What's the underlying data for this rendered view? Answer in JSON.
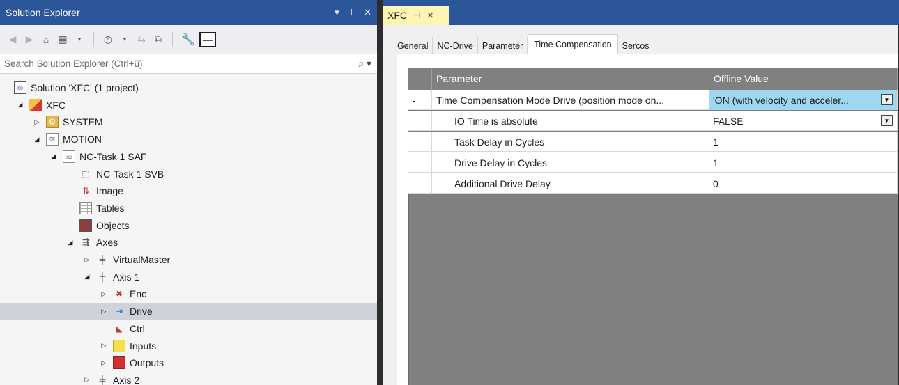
{
  "solution_explorer": {
    "title": "Solution Explorer",
    "title_controls": [
      "▾",
      "⊥",
      "✕"
    ],
    "search_placeholder": "Search Solution Explorer (Ctrl+ü)",
    "tree": [
      {
        "label": "Solution 'XFC' (1 project)",
        "level": 0,
        "expander": "",
        "icon": "solution-icon"
      },
      {
        "label": "XFC",
        "level": 1,
        "expander": "◢",
        "icon": "project-icon"
      },
      {
        "label": "SYSTEM",
        "level": 2,
        "expander": "▷",
        "icon": "system-icon"
      },
      {
        "label": "MOTION",
        "level": 2,
        "expander": "◢",
        "icon": "motion-icon"
      },
      {
        "label": "NC-Task 1 SAF",
        "level": 3,
        "expander": "◢",
        "icon": "nc-task-icon"
      },
      {
        "label": "NC-Task 1 SVB",
        "level": 4,
        "expander": "",
        "icon": "svb-icon"
      },
      {
        "label": "Image",
        "level": 4,
        "expander": "",
        "icon": "image-icon"
      },
      {
        "label": "Tables",
        "level": 4,
        "expander": "",
        "icon": "tables-icon"
      },
      {
        "label": "Objects",
        "level": 4,
        "expander": "",
        "icon": "objects-icon"
      },
      {
        "label": "Axes",
        "level": 4,
        "expander": "◢",
        "icon": "axes-icon"
      },
      {
        "label": "VirtualMaster",
        "level": 5,
        "expander": "▷",
        "icon": "axis-icon"
      },
      {
        "label": "Axis 1",
        "level": 5,
        "expander": "◢",
        "icon": "axis-icon"
      },
      {
        "label": "Enc",
        "level": 6,
        "expander": "▷",
        "icon": "encoder-icon"
      },
      {
        "label": "Drive",
        "level": 6,
        "expander": "▷",
        "icon": "drive-icon",
        "selected": true
      },
      {
        "label": "Ctrl",
        "level": 6,
        "expander": "",
        "icon": "controller-icon"
      },
      {
        "label": "Inputs",
        "level": 6,
        "expander": "▷",
        "icon": "inputs-icon"
      },
      {
        "label": "Outputs",
        "level": 6,
        "expander": "▷",
        "icon": "outputs-icon"
      },
      {
        "label": "Axis 2",
        "level": 5,
        "expander": "▷",
        "icon": "axis-icon"
      }
    ]
  },
  "document": {
    "tab_title": "XFC",
    "tab_pin": "⊣",
    "tab_close": "✕",
    "tabs": [
      "General",
      "NC-Drive",
      "Parameter",
      "Time Compensation",
      "Sercos"
    ],
    "active_tab": "Time Compensation",
    "grid": {
      "columns": [
        "Parameter",
        "Offline Value"
      ],
      "rows": [
        {
          "marker": "-",
          "parameter": "Time Compensation Mode Drive (position mode on...",
          "value": "'ON (with velocity and acceler...",
          "dropdown": true,
          "highlight": true,
          "indent": false
        },
        {
          "marker": "",
          "parameter": "IO Time is absolute",
          "value": "FALSE",
          "dropdown": true,
          "highlight": false,
          "indent": true
        },
        {
          "marker": "",
          "parameter": "Task Delay in Cycles",
          "value": "1",
          "dropdown": false,
          "highlight": false,
          "indent": true
        },
        {
          "marker": "",
          "parameter": "Drive Delay in Cycles",
          "value": "1",
          "dropdown": false,
          "highlight": false,
          "indent": true
        },
        {
          "marker": "",
          "parameter": "Additional Drive Delay",
          "value": "0",
          "dropdown": false,
          "highlight": false,
          "indent": true
        }
      ]
    }
  }
}
